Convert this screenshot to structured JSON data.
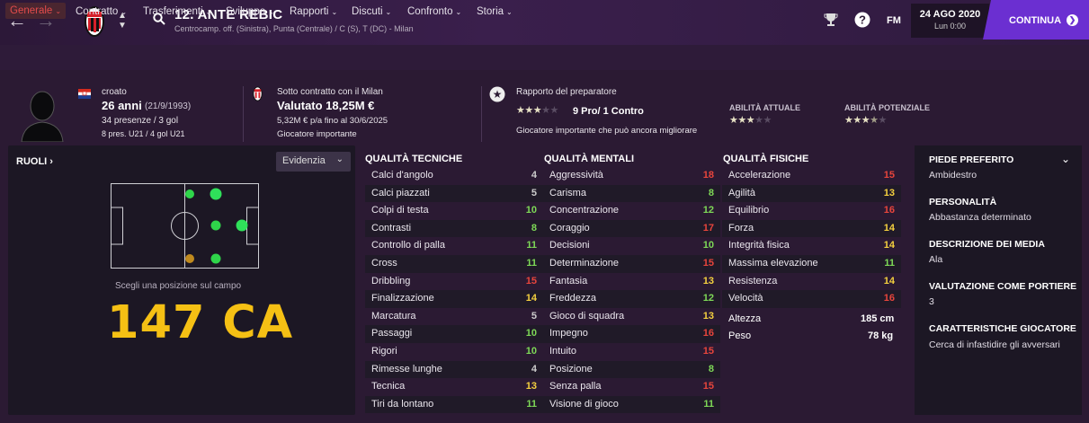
{
  "header": {
    "player_name": "12. ANTE REBIC",
    "positions": "Centrocamp. off. (Sinistra), Punta (Centrale) / C (S), T (DC) - Milan",
    "fm_logo": "FM",
    "date": "24 AGO 2020",
    "time": "Lun 0:00",
    "continue_label": "CONTINUA"
  },
  "tabs": [
    {
      "label": "Generale",
      "active": true
    },
    {
      "label": "Contratto"
    },
    {
      "label": "Trasferimenti"
    },
    {
      "label": "Sviluppo"
    },
    {
      "label": "Rapporti"
    },
    {
      "label": "Discuti"
    },
    {
      "label": "Confronto"
    },
    {
      "label": "Storia"
    }
  ],
  "summary": {
    "nationality": "croato",
    "age": "26 anni",
    "dob": "(21/9/1993)",
    "apps": "34 presenze / 3 gol",
    "u21": "8 pres. U21 / 4 gol U21",
    "contract": "Sotto contratto con il Milan",
    "value": "Valutato 18,25M €",
    "wage": "5,32M € p/a fino al 30/6/2025",
    "status": "Giocatore importante",
    "coach_report": "Rapporto del preparatore",
    "pro_contro": "9 Pro/ 1 Contro",
    "coach_note": "Giocatore importante che può ancora migliorare",
    "current_ability_label": "ABILITÀ ATTUALE",
    "potential_ability_label": "ABILITÀ POTENZIALE",
    "coach_stars": 3,
    "current_ability_stars": 3,
    "potential_ability_stars": 3.5
  },
  "roles": {
    "label": "RUOLI",
    "highlight_label": "Evidenzia",
    "choose_position": "Scegli una posizione sul campo",
    "ca_text": "147 CA"
  },
  "technical": {
    "title": "QUALITÀ TECNICHE",
    "rows": [
      {
        "name": "Calci d'angolo",
        "value": "4"
      },
      {
        "name": "Calci piazzati",
        "value": "5"
      },
      {
        "name": "Colpi di testa",
        "value": "10"
      },
      {
        "name": "Contrasti",
        "value": "8"
      },
      {
        "name": "Controllo di palla",
        "value": "11"
      },
      {
        "name": "Cross",
        "value": "11"
      },
      {
        "name": "Dribbling",
        "value": "15"
      },
      {
        "name": "Finalizzazione",
        "value": "14"
      },
      {
        "name": "Marcatura",
        "value": "5"
      },
      {
        "name": "Passaggi",
        "value": "10"
      },
      {
        "name": "Rigori",
        "value": "10"
      },
      {
        "name": "Rimesse lunghe",
        "value": "4"
      },
      {
        "name": "Tecnica",
        "value": "13"
      },
      {
        "name": "Tiri da lontano",
        "value": "11"
      }
    ]
  },
  "mental": {
    "title": "QUALITÀ MENTALI",
    "rows": [
      {
        "name": "Aggressività",
        "value": "18"
      },
      {
        "name": "Carisma",
        "value": "8"
      },
      {
        "name": "Concentrazione",
        "value": "12"
      },
      {
        "name": "Coraggio",
        "value": "17"
      },
      {
        "name": "Decisioni",
        "value": "10"
      },
      {
        "name": "Determinazione",
        "value": "15"
      },
      {
        "name": "Fantasia",
        "value": "13"
      },
      {
        "name": "Freddezza",
        "value": "12"
      },
      {
        "name": "Gioco di squadra",
        "value": "13"
      },
      {
        "name": "Impegno",
        "value": "16"
      },
      {
        "name": "Intuito",
        "value": "15"
      },
      {
        "name": "Posizione",
        "value": "8"
      },
      {
        "name": "Senza palla",
        "value": "15"
      },
      {
        "name": "Visione di gioco",
        "value": "11"
      }
    ]
  },
  "physical": {
    "title": "QUALITÀ FISICHE",
    "rows": [
      {
        "name": "Accelerazione",
        "value": "15"
      },
      {
        "name": "Agilità",
        "value": "13"
      },
      {
        "name": "Equilibrio",
        "value": "16"
      },
      {
        "name": "Forza",
        "value": "14"
      },
      {
        "name": "Integrità fisica",
        "value": "14"
      },
      {
        "name": "Massima elevazione",
        "value": "11"
      },
      {
        "name": "Resistenza",
        "value": "14"
      },
      {
        "name": "Velocità",
        "value": "16"
      }
    ],
    "height_label": "Altezza",
    "height_value": "185 cm",
    "weight_label": "Peso",
    "weight_value": "78 kg"
  },
  "details": {
    "foot_label": "PIEDE PREFERITO",
    "foot_value": "Ambidestro",
    "personality_label": "PERSONALITÀ",
    "personality_value": "Abbastanza determinato",
    "media_label": "DESCRIZIONE DEI MEDIA",
    "media_value": "Ala",
    "gk_label": "VALUTAZIONE COME PORTIERE",
    "gk_value": "3",
    "traits_label": "CARATTERISTICHE GIOCATORE",
    "traits_value": "Cerca di infastidire gli avversari"
  },
  "colors": {
    "accent_purple": "#6b2fd1",
    "ca_yellow": "#f5c014",
    "val_red": "#e8453c",
    "val_yellow": "#f4d03f",
    "val_green": "#7ed957",
    "val_gray": "#cccccc"
  }
}
